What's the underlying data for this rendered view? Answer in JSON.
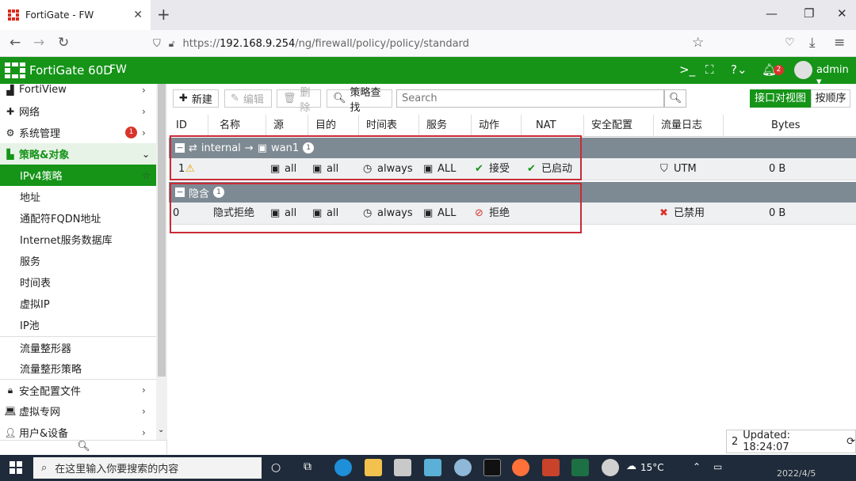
{
  "browser": {
    "tab_title": "FortiGate - FW",
    "url_prefix": "https://",
    "url_host": "192.168.9.254",
    "url_path": "/ng/firewall/policy/policy/standard"
  },
  "header": {
    "product": "FortiGate 60D",
    "hostname": "FW",
    "alerts": "2",
    "user": "admin",
    "color": "#159418"
  },
  "sidebar": {
    "items": [
      {
        "label": "FortiView"
      },
      {
        "label": "网络"
      },
      {
        "label": "系统管理",
        "badge": "1"
      },
      {
        "label": "策略&对象"
      },
      {
        "label": "IPv4策略"
      },
      {
        "label": "地址"
      },
      {
        "label": "通配符FQDN地址"
      },
      {
        "label": "Internet服务数据库"
      },
      {
        "label": "服务"
      },
      {
        "label": "时间表"
      },
      {
        "label": "虚拟IP"
      },
      {
        "label": "IP池"
      },
      {
        "label": "流量整形器"
      },
      {
        "label": "流量整形策略"
      },
      {
        "label": "安全配置文件"
      },
      {
        "label": "虚拟专网"
      },
      {
        "label": "用户&设备"
      }
    ]
  },
  "toolbar": {
    "new": "新建",
    "edit": "编辑",
    "delete": "删除",
    "find": "策略查找",
    "search_placeholder": "Search",
    "view_interface": "接口对视图",
    "view_sequence": "按顺序"
  },
  "table": {
    "columns": [
      "ID",
      "名称",
      "源",
      "目的",
      "时间表",
      "服务",
      "动作",
      "NAT",
      "安全配置",
      "流量日志",
      "Bytes"
    ],
    "groups": [
      {
        "src_if": "internal",
        "arrow": "→",
        "dst_if": "wan1",
        "count": "1",
        "rows": [
          {
            "id": "1",
            "name": "",
            "src": "all",
            "dst": "all",
            "schedule": "always",
            "service": "ALL",
            "action": "接受",
            "nat": "已启动",
            "security": "",
            "log": "UTM",
            "bytes": "0 B"
          }
        ]
      },
      {
        "label": "隐含",
        "count": "1",
        "rows": [
          {
            "id": "0",
            "name": "隐式拒绝",
            "src": "all",
            "dst": "all",
            "schedule": "always",
            "service": "ALL",
            "action": "拒绝",
            "nat": "",
            "security": "",
            "log": "已禁用",
            "bytes": "0 B"
          }
        ]
      }
    ]
  },
  "status": {
    "count": "2",
    "updated": "Updated: 18:24:07"
  },
  "taskbar": {
    "search_text": "在这里输入你要搜索的内容",
    "temperature": "15°C",
    "date": "2022/4/5"
  }
}
